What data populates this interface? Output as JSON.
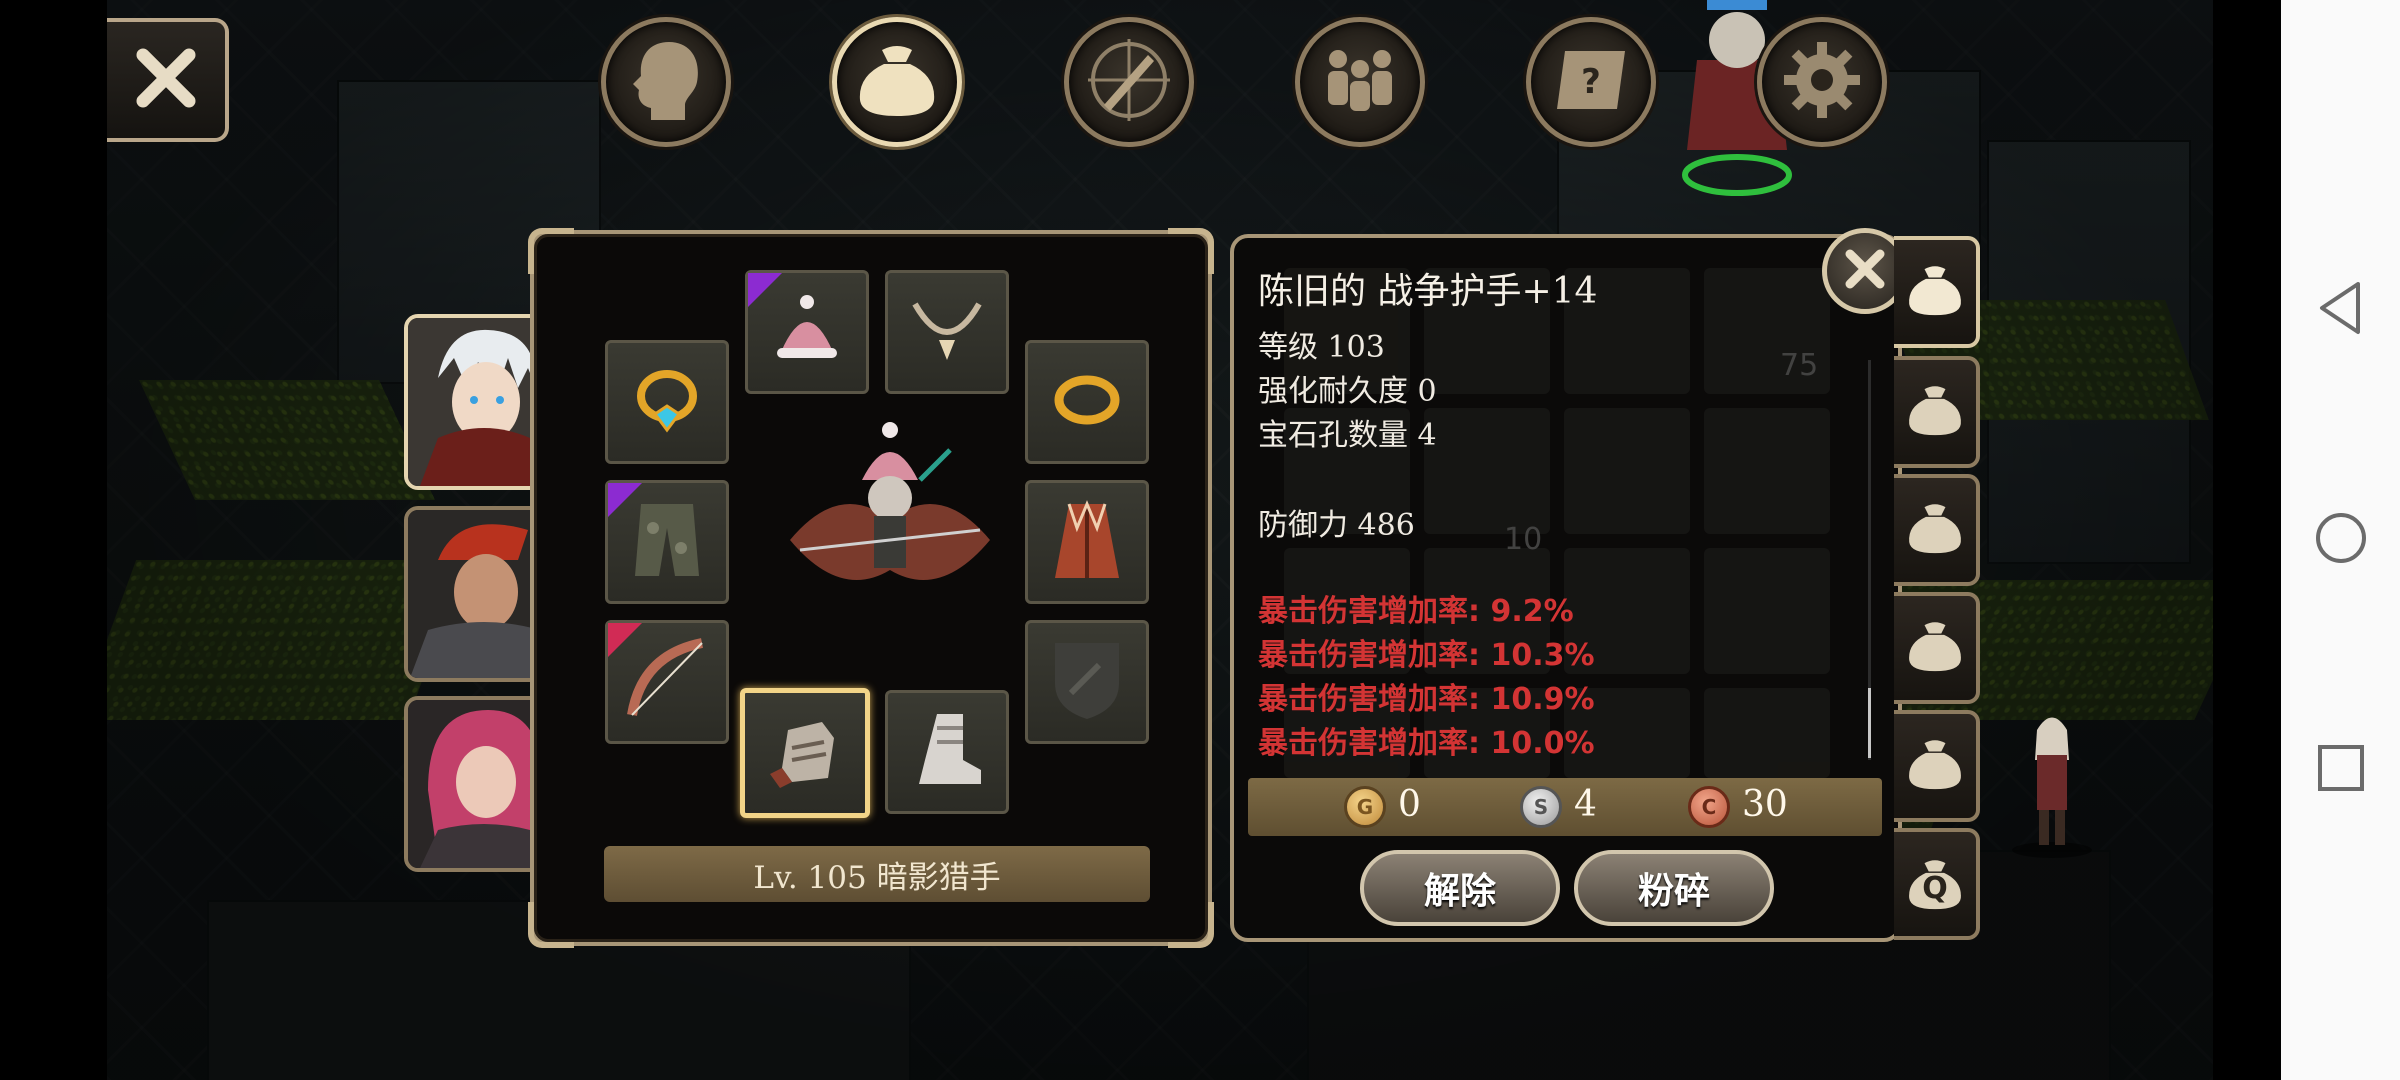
{
  "top_tabs": [
    {
      "name": "character",
      "icon": "head-icon"
    },
    {
      "name": "inventory",
      "icon": "bag-icon",
      "active": true
    },
    {
      "name": "skills",
      "icon": "sword-compass-icon"
    },
    {
      "name": "party",
      "icon": "party-icon"
    },
    {
      "name": "quests",
      "icon": "scroll-icon"
    },
    {
      "name": "settings",
      "icon": "gear-icon"
    }
  ],
  "character": {
    "level_label": "Lv. 105 暗影猎手"
  },
  "equipment_slots": [
    {
      "slot": "ring-left",
      "icon": "blue-gem-ring-icon"
    },
    {
      "slot": "helmet",
      "icon": "pink-hat-icon",
      "rarity": "purple"
    },
    {
      "slot": "necklace",
      "icon": "necklace-icon"
    },
    {
      "slot": "ring-right",
      "icon": "gold-ring-icon"
    },
    {
      "slot": "pants",
      "icon": "camo-pants-icon",
      "rarity": "purple"
    },
    {
      "slot": "armor",
      "icon": "red-coat-icon"
    },
    {
      "slot": "weapon",
      "icon": "bow-icon",
      "rarity": "red"
    },
    {
      "slot": "shield",
      "icon": "shield-placeholder-icon"
    },
    {
      "slot": "gloves",
      "icon": "gauntlet-icon",
      "selected": true
    },
    {
      "slot": "boots",
      "icon": "boot-icon"
    }
  ],
  "item": {
    "name": "陈旧的 战争护手+14",
    "level": "等级 103",
    "durability": "强化耐久度 0",
    "sockets": "宝石孔数量 4",
    "defense": "防御力 486",
    "bonuses": [
      "暴击伤害增加率: 9.2%",
      "暴击伤害增加率: 10.3%",
      "暴击伤害增加率: 10.9%",
      "暴击伤害增加率: 10.0%"
    ]
  },
  "bag_background_numbers": [
    "75",
    "10"
  ],
  "currency": {
    "gold": {
      "letter": "G",
      "value": "0"
    },
    "silver": {
      "letter": "S",
      "value": "4"
    },
    "copper": {
      "letter": "C",
      "value": "30"
    }
  },
  "buttons": {
    "unequip": "解除",
    "shatter": "粉碎"
  },
  "bag_tabs": [
    {
      "icon": "bag-icon",
      "active": true
    },
    {
      "icon": "bag-icon"
    },
    {
      "icon": "bag-icon"
    },
    {
      "icon": "bag-icon"
    },
    {
      "icon": "bag-icon"
    },
    {
      "icon": "bag-search-icon",
      "label": "Q"
    }
  ],
  "colors": {
    "accent_gold": "#d8c8a3",
    "bonus_red": "#d33434",
    "rarity_purple": "#8c2bd1",
    "rarity_red": "#d12b55"
  }
}
